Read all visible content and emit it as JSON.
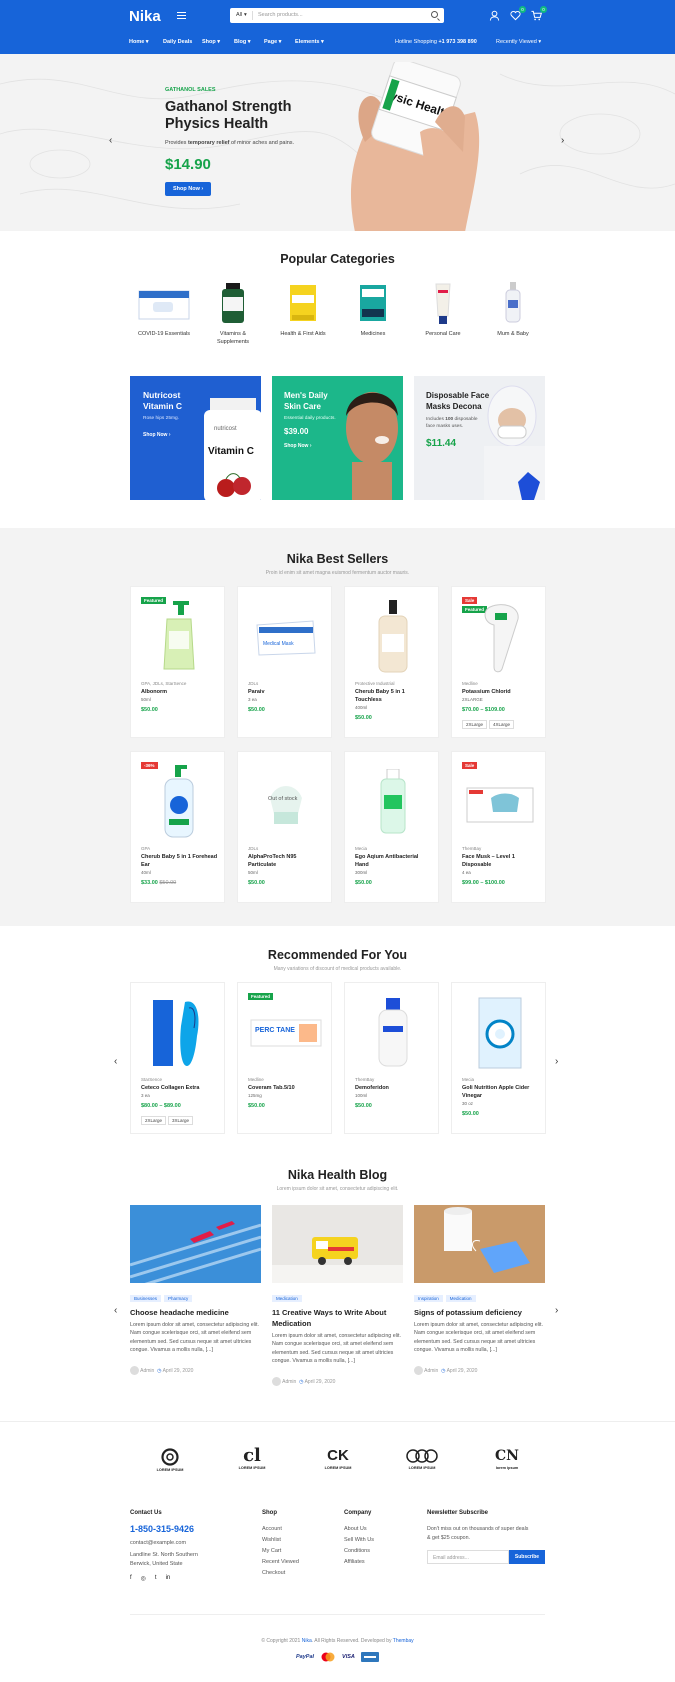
{
  "header": {
    "logo": "Nika",
    "search_cat": "All",
    "search_placeholder": "Search products...",
    "wishlist_count": "0",
    "cart_count": "0"
  },
  "nav": {
    "items": [
      "Home",
      "Daily Deals",
      "Shop",
      "Blog",
      "Page",
      "Elements"
    ],
    "hotline_label": "Hotline Shopping",
    "hotline_number": "+1 973 398 890",
    "recent": "Recently Viewed"
  },
  "hero": {
    "kicker": "GATHANOL SALES",
    "title1": "Gathanol Strength",
    "title2": "Physics Health",
    "desc_pre": "Provides ",
    "desc_bold": "temporary relief",
    "desc_post": " of minor aches and pains.",
    "price": "$14.90",
    "button": "Shop Now",
    "bottle_text": "ysic Health"
  },
  "categories": {
    "title": "Popular Categories",
    "items": [
      {
        "label1": "COVID-19 Essentials",
        "label2": ""
      },
      {
        "label1": "Vitamins &",
        "label2": "Supplements"
      },
      {
        "label1": "Health & First Aids",
        "label2": ""
      },
      {
        "label1": "Medicines",
        "label2": ""
      },
      {
        "label1": "Personal Care",
        "label2": ""
      },
      {
        "label1": "Mum & Baby",
        "label2": ""
      }
    ]
  },
  "banners": [
    {
      "title1": "Nutricost",
      "title2": "Vitamin C",
      "desc": "Rose hips 25mg.",
      "cta": "Shop Now",
      "bottle_brand": "nutricost",
      "bottle_title": "Vitamin C"
    },
    {
      "title1": "Men's Daily",
      "title2": "Skin Care",
      "desc": "Essential daily products.",
      "price": "$39.00",
      "cta": "Shop Now"
    },
    {
      "title1": "Disposable Face",
      "title2": "Masks Decona",
      "desc_pre": "Includes ",
      "desc_bold": "100",
      "desc_post": " disposable",
      "desc2": "face masks uses.",
      "price": "$11.44"
    }
  ],
  "bestsellers": {
    "title": "Nika Best Sellers",
    "subtitle": "Proin id enim sit amet magna euismod fermentum auctor mauris.",
    "products": [
      {
        "tags": [
          "Featured"
        ],
        "brand": "GPA, JDLs, StarSence",
        "name": "Albonorm",
        "unit": "50ml",
        "price": "$50.00"
      },
      {
        "tags": [],
        "brand": "JDLs",
        "name": "Paraiv",
        "unit": "3 ea",
        "price": "$50.00",
        "box_text": "Medical Mask"
      },
      {
        "tags": [],
        "brand": "Protective Industrial",
        "name": "Cherub Baby 5 in 1 Touchless",
        "unit": "400ml",
        "price": "$50.00"
      },
      {
        "tags": [
          "Sale",
          "Featured"
        ],
        "brand": "Medline",
        "name": "Potassium Chlorid",
        "unit": "2XLARGE",
        "price": "$70.00 – $109.00",
        "options": [
          "2XLarge",
          "4XLarge"
        ]
      },
      {
        "tags": [
          "-36%"
        ],
        "brand": "GPA",
        "name": "Cherub Baby 5 in 1 Forehead Ear",
        "unit": "40ml",
        "price": "$33.00",
        "old_price": "$50.00"
      },
      {
        "tags": [],
        "brand": "JDLs",
        "name": "AlphaProTech N95 Particulate",
        "unit": "50ml",
        "price": "$50.00",
        "overlay": "Out of stock"
      },
      {
        "tags": [],
        "brand": "Mecia",
        "name": "Ego Aqium Antibacterial Hand",
        "unit": "300ml",
        "price": "$50.00"
      },
      {
        "tags": [
          "Sale"
        ],
        "brand": "ThemBay",
        "name": "Face Musk – Level 1 Disposable",
        "unit": "4 ea",
        "price": "$99.00 – $100.00"
      }
    ]
  },
  "recommended": {
    "title": "Recommended For You",
    "subtitle": "Many variations of discount of medical products available.",
    "products": [
      {
        "tags": [],
        "brand": "StarSence",
        "name": "Ceteco Collagen Extra",
        "unit": "3 ea",
        "price": "$80.00 – $89.00",
        "options": [
          "2XLarge",
          "3XLarge"
        ]
      },
      {
        "tags": [
          "Featured"
        ],
        "brand": "Medline",
        "name": "Coveram Tab.5/10",
        "unit": "125mg",
        "price": "$50.00",
        "box_text": "PERC  TANE"
      },
      {
        "tags": [],
        "brand": "ThemBay",
        "name": "Demoferidon",
        "unit": "100ml",
        "price": "$50.00"
      },
      {
        "tags": [],
        "brand": "Mecia",
        "name": "Goli Nutrition Apple Cider Vinegar",
        "unit": "30 oz",
        "price": "$50.00"
      }
    ]
  },
  "blog": {
    "title": "Nika Health Blog",
    "subtitle": "Lorem ipsum dolor sit amet, consectetur adipiscing elit.",
    "posts": [
      {
        "tags": [
          "Businesses",
          "Pharmacy"
        ],
        "title1": "Choose headache medicine",
        "title2": "",
        "excerpt": "Lorem ipsum dolor sit amet, consectetur adipiscing elit. Nam congue scelerisque orci, sit amet eleifend sem elementum sed. Sed cursus neque sit amet ultricies congue. Vivamus a mollis nulla, [...]",
        "author": "Admin",
        "date": "April 29, 2020"
      },
      {
        "tags": [
          "Medication"
        ],
        "title1": "11 Creative Ways to Write About",
        "title2": "Medication",
        "excerpt": "Lorem ipsum dolor sit amet, consectetur adipiscing elit. Nam congue scelerisque orci, sit amet eleifend sem elementum sed. Sed cursus neque sit amet ultricies congue. Vivamus a mollis nulla, [...]",
        "author": "Admin",
        "date": "April 29, 2020"
      },
      {
        "tags": [
          "Inspiration",
          "Medication"
        ],
        "title1": "Signs of potassium deficiency",
        "title2": "",
        "excerpt": "Lorem ipsum dolor sit amet, consectetur adipiscing elit. Nam congue scelerisque orci, sit amet eleifend sem elementum sed. Sed cursus neque sit amet ultricies congue. Vivamus a mollis nulla, [...]",
        "author": "Admin",
        "date": "April 29, 2020"
      }
    ]
  },
  "brands": [
    "LOREM IPSUM",
    "LOREM IPSUM",
    "LOREM IPSUM",
    "LOREM IPSUM",
    "lorem ipsum"
  ],
  "footer": {
    "contact_title": "Contact Us",
    "phone": "1-850-315-9426",
    "email": "contact@example.com",
    "address1": "Landline St. North Southern",
    "address2": "Berwick, United State",
    "shop_title": "Shop",
    "shop_links": [
      "Account",
      "Wishlist",
      "My Cart",
      "Recent Viewed",
      "Checkout"
    ],
    "company_title": "Company",
    "company_links": [
      "About Us",
      "Sell With Us",
      "Conditions",
      "Affiliates"
    ],
    "news_title": "Newsletter Subscribe",
    "news_desc1": "Don't miss out on thousands of super deals",
    "news_desc2": "& get $25 coupon.",
    "email_placeholder": "Email address...",
    "subscribe": "Subscribe",
    "copyright_pre": "© Copyright 2021 ",
    "copyright_brand": "Nika",
    "copyright_mid": ". All Rights Reserved. Developed by ",
    "copyright_dev": "Thembay",
    "payments": [
      "PayPal",
      "VISA"
    ]
  },
  "colors": {
    "primary": "#1764d9",
    "green": "#16a34a",
    "sale": "#e53935",
    "featured": "#16a34a",
    "teal": "#10b981"
  }
}
